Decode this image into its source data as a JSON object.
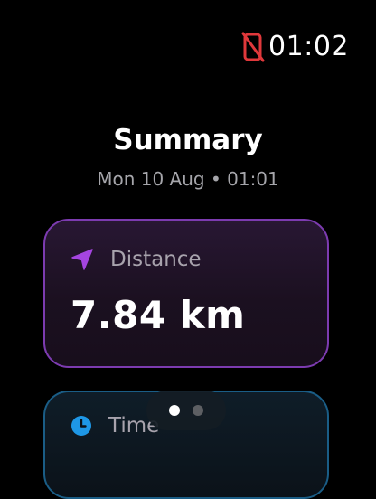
{
  "status": {
    "time": "01:02",
    "connection_icon": "phone-disconnected-icon",
    "connection_color": "#e0383b"
  },
  "summary": {
    "title": "Summary",
    "subtitle": "Mon 10 Aug • 01:01"
  },
  "cards": [
    {
      "label": "Distance",
      "value": "7.84 km",
      "icon": "location-arrow-icon",
      "accent": "#a545e0"
    },
    {
      "label": "Time",
      "icon": "clock-icon",
      "accent": "#1e97e6"
    }
  ],
  "pager": {
    "pages": 2,
    "active": 1
  }
}
